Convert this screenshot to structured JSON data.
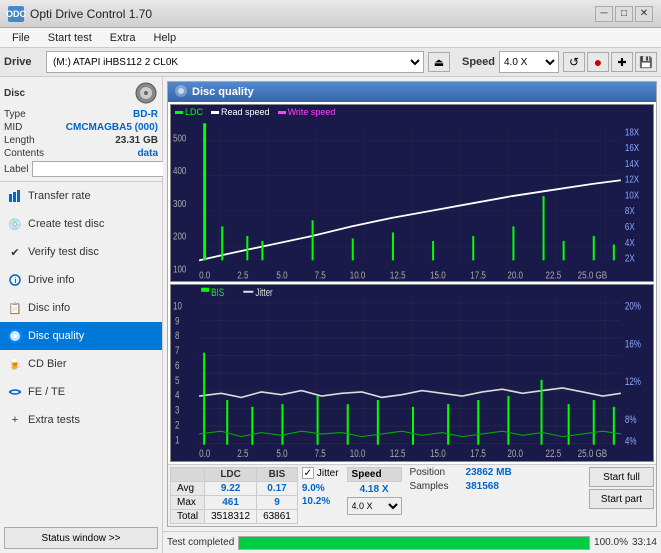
{
  "titlebar": {
    "title": "Opti Drive Control 1.70",
    "icon": "ODC",
    "minimize": "─",
    "maximize": "□",
    "close": "✕"
  },
  "menubar": {
    "items": [
      "File",
      "Start test",
      "Extra",
      "Help"
    ]
  },
  "toolbar": {
    "drive_label": "Drive",
    "drive_value": "(M:)  ATAPI iHBS112  2 CL0K",
    "eject_icon": "⏏",
    "speed_label": "Speed",
    "speed_value": "4.0 X",
    "icon1": "↺",
    "icon2": "●",
    "icon3": "⊕",
    "icon4": "💾"
  },
  "disc": {
    "label": "Disc",
    "type_key": "Type",
    "type_val": "BD-R",
    "mid_key": "MID",
    "mid_val": "CMCMAGBA5 (000)",
    "length_key": "Length",
    "length_val": "23.31 GB",
    "contents_key": "Contents",
    "contents_val": "data",
    "label_key": "Label",
    "label_val": ""
  },
  "nav": {
    "items": [
      {
        "id": "transfer-rate",
        "label": "Transfer rate",
        "icon": "📊"
      },
      {
        "id": "create-test-disc",
        "label": "Create test disc",
        "icon": "💿"
      },
      {
        "id": "verify-test-disc",
        "label": "Verify test disc",
        "icon": "✔"
      },
      {
        "id": "drive-info",
        "label": "Drive info",
        "icon": "ℹ"
      },
      {
        "id": "disc-info",
        "label": "Disc info",
        "icon": "📋"
      },
      {
        "id": "disc-quality",
        "label": "Disc quality",
        "icon": "◉",
        "active": true
      },
      {
        "id": "cd-bier",
        "label": "CD Bier",
        "icon": "🍺"
      },
      {
        "id": "fe-te",
        "label": "FE / TE",
        "icon": "〰"
      },
      {
        "id": "extra-tests",
        "label": "Extra tests",
        "icon": "+"
      }
    ]
  },
  "status_btn": "Status window >>",
  "quality_panel": {
    "title": "Disc quality",
    "legend": {
      "ldc": "LDC",
      "read": "Read speed",
      "write": "Write speed"
    },
    "chart_top": {
      "y_left": [
        "500",
        "400",
        "300",
        "200",
        "100"
      ],
      "y_right": [
        "18X",
        "16X",
        "14X",
        "12X",
        "10X",
        "8X",
        "6X",
        "4X",
        "2X"
      ],
      "x_labels": [
        "0.0",
        "2.5",
        "5.0",
        "7.5",
        "10.0",
        "12.5",
        "15.0",
        "17.5",
        "20.0",
        "22.5",
        "25.0 GB"
      ]
    },
    "chart_bottom": {
      "title_bis": "BIS",
      "title_jitter": "Jitter",
      "y_left": [
        "10",
        "9",
        "8",
        "7",
        "6",
        "5",
        "4",
        "3",
        "2",
        "1"
      ],
      "y_right": [
        "20%",
        "16%",
        "12%",
        "8%",
        "4%"
      ],
      "x_labels": [
        "0.0",
        "2.5",
        "5.0",
        "7.5",
        "10.0",
        "12.5",
        "15.0",
        "17.5",
        "20.0",
        "22.5",
        "25.0 GB"
      ]
    }
  },
  "stats": {
    "col_headers": [
      "LDC",
      "BIS",
      "",
      "Jitter",
      "Speed"
    ],
    "avg_label": "Avg",
    "max_label": "Max",
    "total_label": "Total",
    "ldc_avg": "9.22",
    "ldc_max": "461",
    "ldc_total": "3518312",
    "bis_avg": "0.17",
    "bis_max": "9",
    "bis_total": "63861",
    "jitter_avg": "9.0%",
    "jitter_max": "10.2%",
    "jitter_total": "",
    "speed_val": "4.18 X",
    "speed_select": "4.0 X",
    "position_label": "Position",
    "position_val": "23862 MB",
    "samples_label": "Samples",
    "samples_val": "381568",
    "jitter_checked": true,
    "jitter_label": "Jitter",
    "start_full": "Start full",
    "start_part": "Start part"
  },
  "bottom": {
    "status_text": "Test completed",
    "progress": 100,
    "time": "33:14"
  }
}
